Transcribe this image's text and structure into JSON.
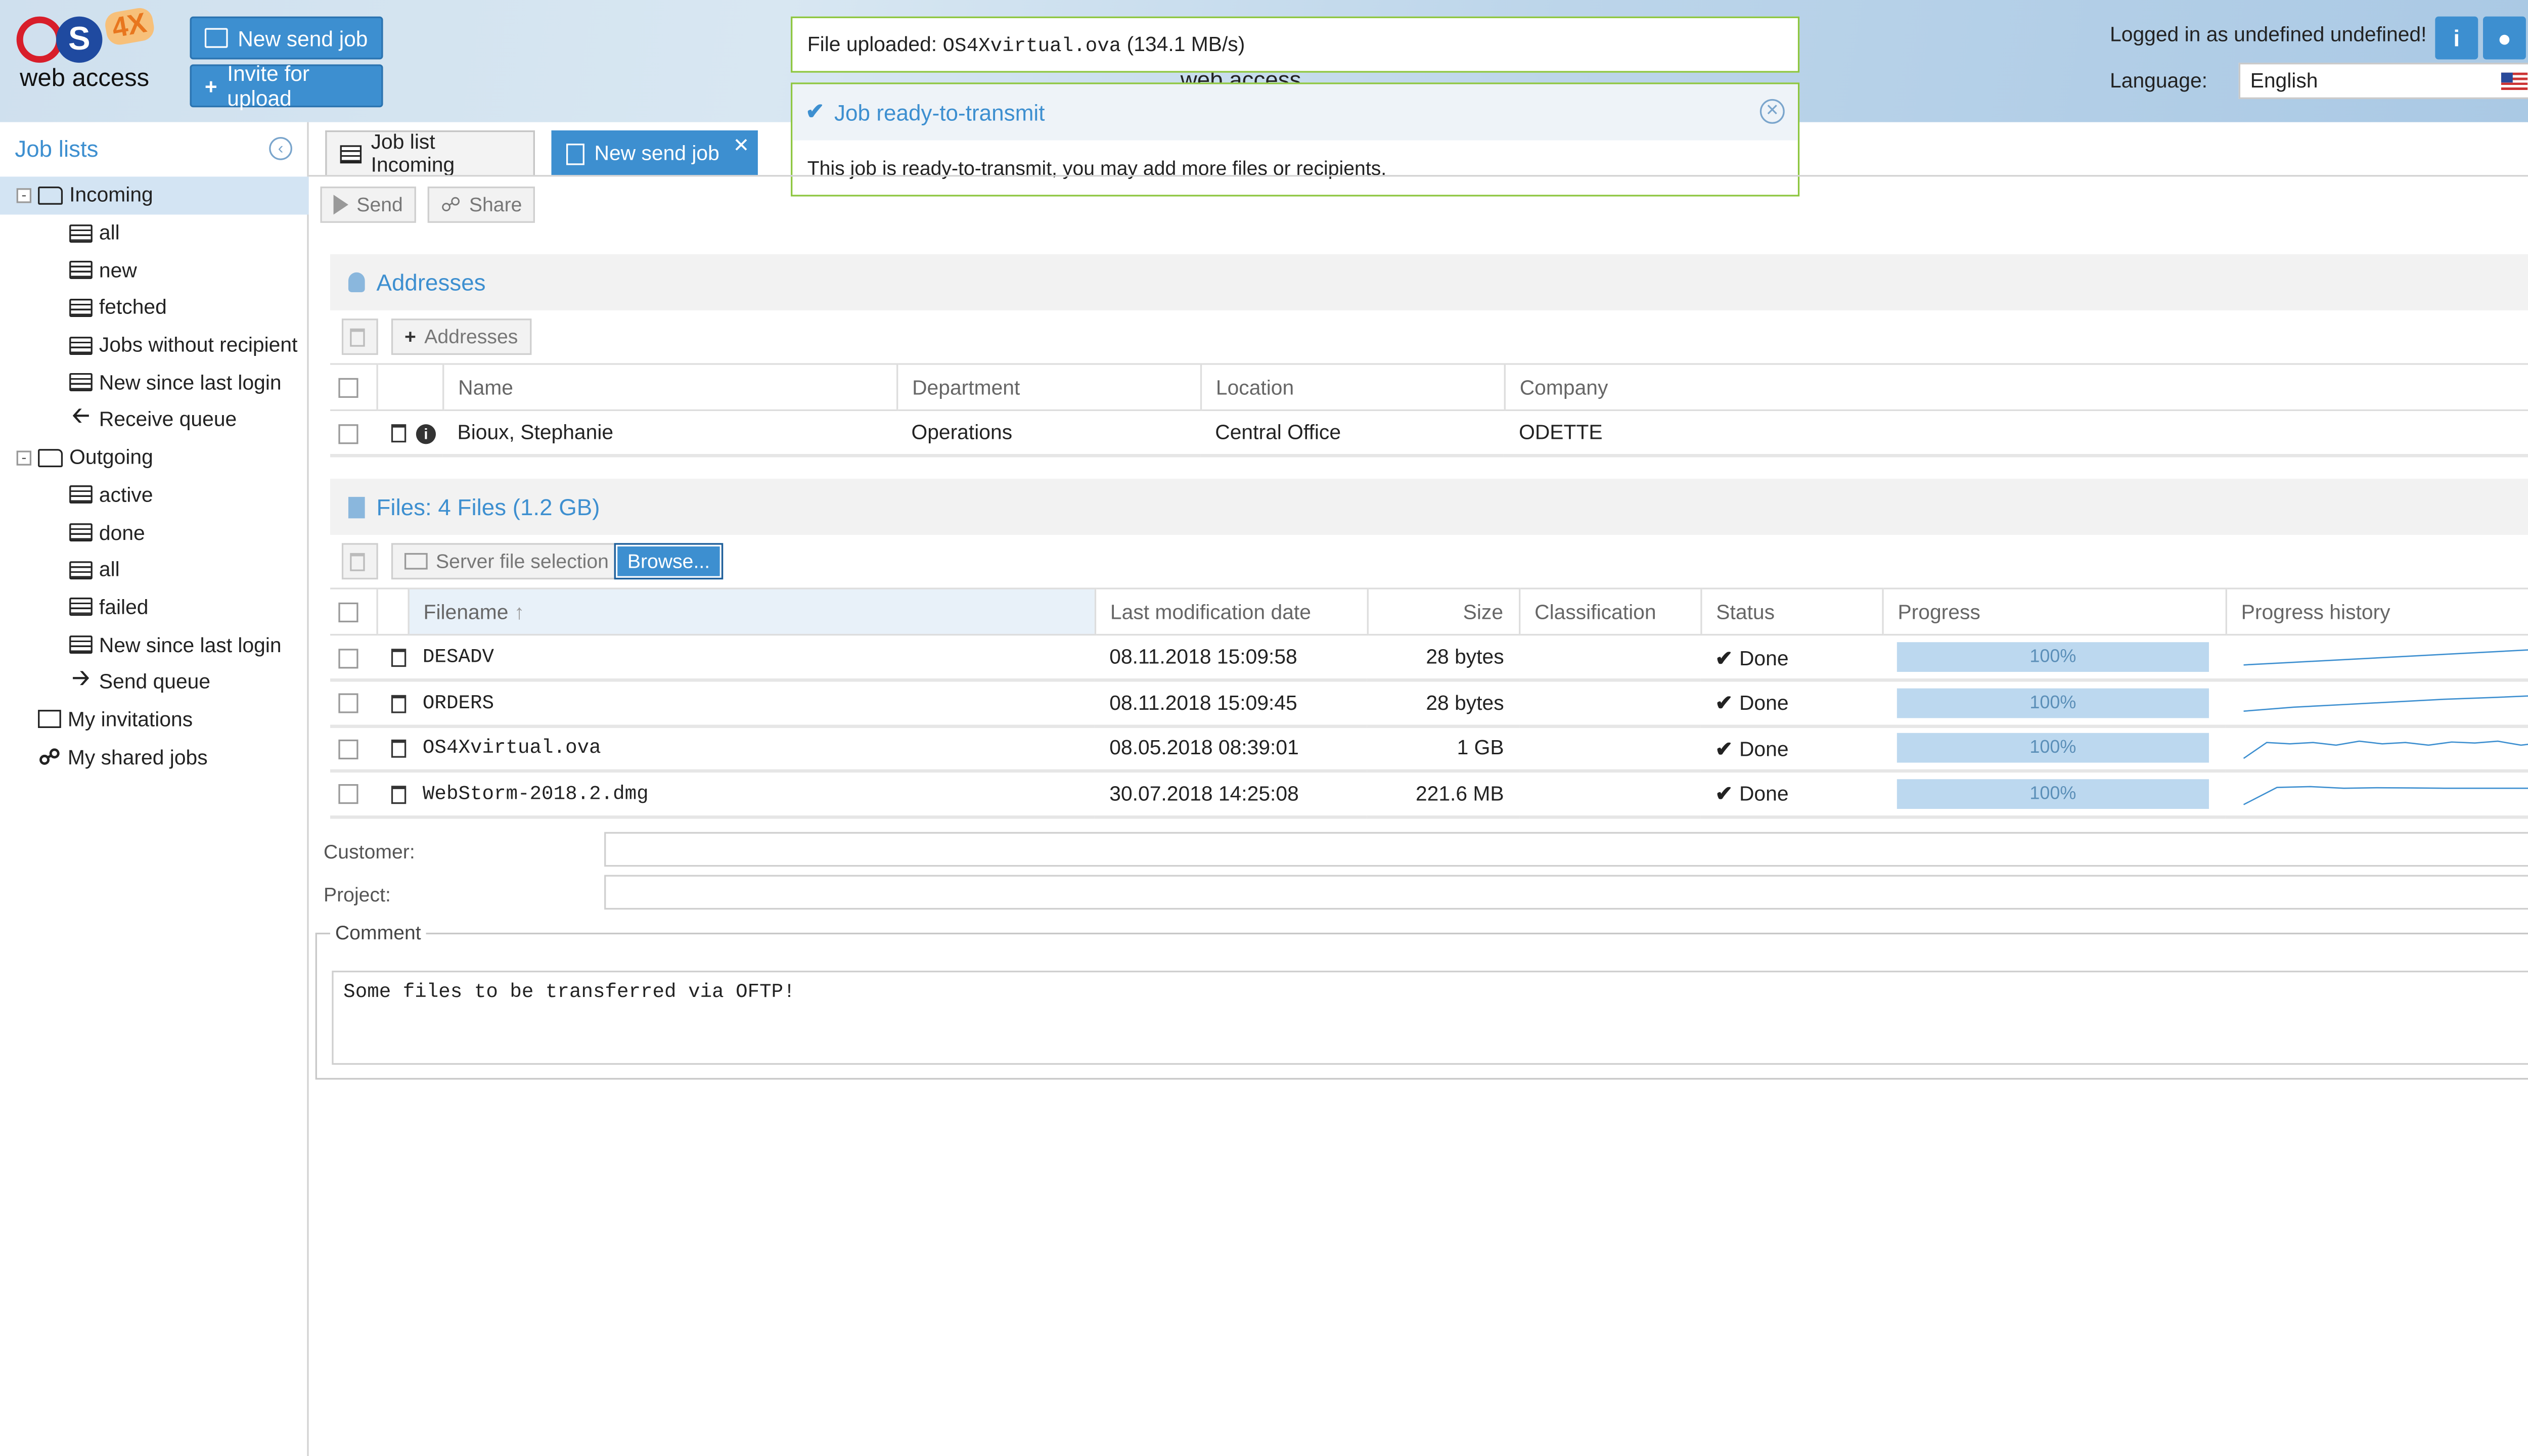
{
  "header": {
    "logo_text": "web access",
    "logo_badge": "4X",
    "new_send_job": "New send job",
    "invite_upload": "Invite for upload",
    "center_title": "web access",
    "logged_in": "Logged in as undefined undefined!",
    "language_label": "Language:",
    "language_value": "English"
  },
  "notifications": {
    "upload_prefix": "File uploaded:",
    "upload_file": "OS4Xvirtual.ova",
    "upload_rate": "(134.1 MB/s)",
    "ready_title": "Job ready-to-transmit",
    "ready_body": "This job is ready-to-transmit, you may add more files or recipients."
  },
  "sidebar": {
    "title": "Job lists",
    "incoming": "Incoming",
    "incoming_items": [
      "all",
      "new",
      "fetched",
      "Jobs without recipient",
      "New since last login",
      "Receive queue"
    ],
    "outgoing": "Outgoing",
    "outgoing_items": [
      "active",
      "done",
      "all",
      "failed",
      "New since last login",
      "Send queue"
    ],
    "my_invitations": "My invitations",
    "my_shared_jobs": "My shared jobs"
  },
  "tabs": {
    "incoming": "Job list Incoming",
    "new_send": "New send job"
  },
  "toolbar": {
    "send": "Send",
    "share": "Share"
  },
  "addresses": {
    "title": "Addresses",
    "add_button": "Addresses",
    "columns": [
      "Name",
      "Department",
      "Location",
      "Company"
    ],
    "rows": [
      {
        "name": "Bioux, Stephanie",
        "department": "Operations",
        "location": "Central Office",
        "company": "ODETTE"
      }
    ]
  },
  "files": {
    "title": "Files: 4 Files (1.2 GB)",
    "server_selection": "Server file selection",
    "browse": "Browse...",
    "columns": [
      "Filename",
      "Last modification date",
      "Size",
      "Classification",
      "Status",
      "Progress",
      "Progress history"
    ],
    "rows": [
      {
        "filename": "DESADV",
        "date": "08.11.2018 15:09:58",
        "size": "28 bytes",
        "classification": "",
        "status": "Done",
        "progress": "100%",
        "history": [
          0.2,
          0.3,
          0.4,
          0.5,
          0.6,
          0.7,
          0.8
        ]
      },
      {
        "filename": "ORDERS",
        "date": "08.11.2018 15:09:45",
        "size": "28 bytes",
        "classification": "",
        "status": "Done",
        "progress": "100%",
        "history": [
          0.2,
          0.35,
          0.45,
          0.55,
          0.65,
          0.72,
          0.8
        ]
      },
      {
        "filename": "OS4Xvirtual.ova",
        "date": "08.05.2018 08:39:01",
        "size": "1 GB",
        "classification": "",
        "status": "Done",
        "progress": "100%",
        "history": [
          0.1,
          0.7,
          0.65,
          0.7,
          0.6,
          0.75,
          0.65,
          0.7,
          0.6,
          0.72,
          0.68,
          0.75,
          0.6,
          0.7
        ]
      },
      {
        "filename": "WebStorm-2018.2.dmg",
        "date": "30.07.2018 14:25:08",
        "size": "221.6 MB",
        "classification": "",
        "status": "Done",
        "progress": "100%",
        "history": [
          0.1,
          0.75,
          0.78,
          0.72,
          0.74,
          0.73,
          0.72,
          0.72,
          0.72,
          0.72
        ]
      }
    ]
  },
  "form": {
    "customer_label": "Customer:",
    "customer_value": "",
    "project_label": "Project:",
    "project_value": "",
    "comment_label": "Comment",
    "comment_value": "Some files to be transferred via OFTP!"
  },
  "colors": {
    "accent": "#3d8fd0",
    "success": "#8dc63f",
    "progress": "#bcd8ef"
  }
}
